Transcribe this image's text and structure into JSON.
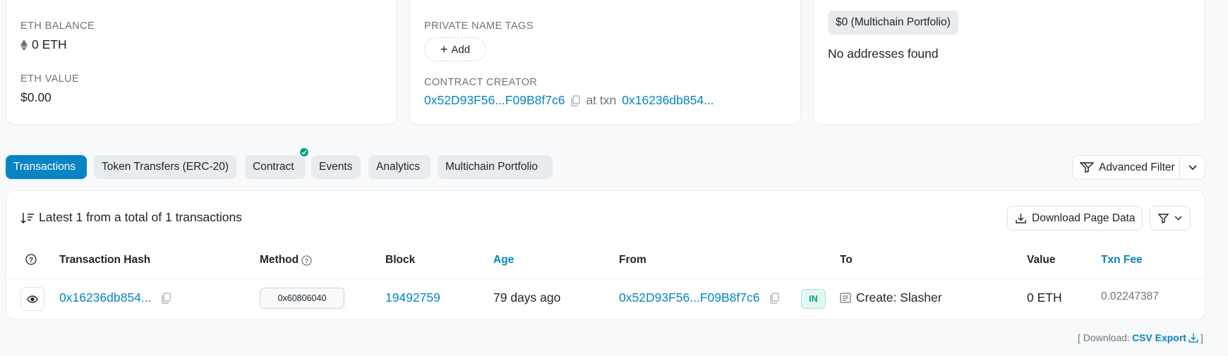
{
  "overview": {
    "eth_balance_label": "ETH BALANCE",
    "eth_balance_value": "0 ETH",
    "eth_value_label": "ETH VALUE",
    "eth_value_value": "$0.00"
  },
  "more_info": {
    "private_tags_label": "PRIVATE NAME TAGS",
    "add_label": "Add",
    "creator_label": "CONTRACT CREATOR",
    "creator_address": "0x52D93F56...F09B8f7c6",
    "at_txn_label": "at txn",
    "creator_txn": "0x16236db854..."
  },
  "multichain": {
    "portfolio_amount": "$0",
    "portfolio_label": "(Multichain Portfolio)",
    "no_addresses": "No addresses found"
  },
  "tabs": [
    {
      "label": "Transactions",
      "active": true
    },
    {
      "label": "Token Transfers (ERC-20)",
      "active": false
    },
    {
      "label": "Contract",
      "active": false,
      "verified": true
    },
    {
      "label": "Events",
      "active": false
    },
    {
      "label": "Analytics",
      "active": false
    },
    {
      "label": "Multichain Portfolio",
      "active": false
    }
  ],
  "advanced_filter_label": "Advanced Filter",
  "transactions": {
    "summary": "Latest 1 from a total of 1 transactions",
    "download_label": "Download Page Data",
    "headers": {
      "hash": "Transaction Hash",
      "method": "Method",
      "block": "Block",
      "age": "Age",
      "from": "From",
      "to": "To",
      "value": "Value",
      "fee": "Txn Fee"
    },
    "rows": [
      {
        "hash": "0x16236db854...",
        "method": "0x60806040",
        "block": "19492759",
        "age": "79 days ago",
        "from": "0x52D93F56...F09B8f7c6",
        "direction": "IN",
        "to": "Create: Slasher",
        "value": "0 ETH",
        "fee": "0.02247387"
      }
    ]
  },
  "csv": {
    "prefix": "[ Download:",
    "link": "CSV Export",
    "suffix": "]"
  },
  "colors": {
    "accent": "#0784c3",
    "success": "#00a186",
    "muted": "#6c757d"
  }
}
